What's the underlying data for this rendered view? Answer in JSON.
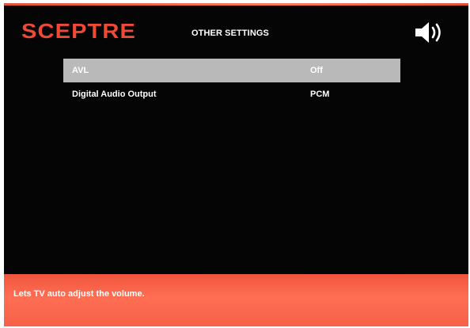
{
  "brand": {
    "logo_text": "SCEPTRE",
    "color": "#f04a35"
  },
  "header": {
    "title": "OTHER SETTINGS",
    "speaker_icon": "speaker-icon"
  },
  "menu": {
    "items": [
      {
        "label": "AVL",
        "value": "Off",
        "selected": true
      },
      {
        "label": "Digital Audio Output",
        "value": "PCM",
        "selected": false
      }
    ]
  },
  "footer": {
    "help_text": "Lets TV auto adjust the volume.",
    "color": "#ff6a50"
  }
}
